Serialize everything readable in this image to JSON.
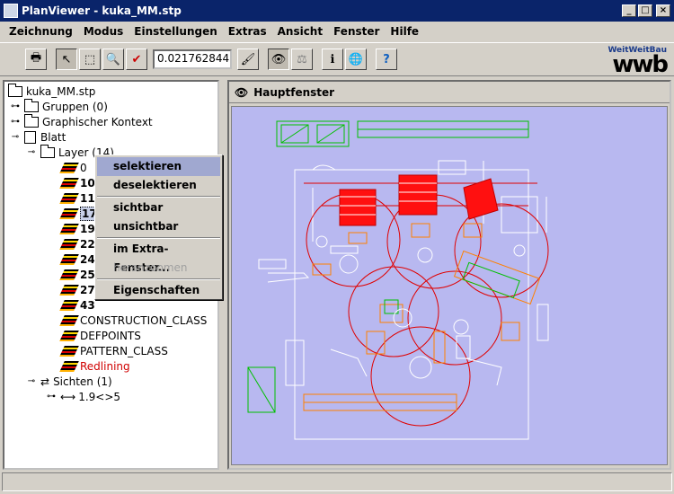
{
  "window": {
    "title": "PlanViewer - kuka_MM.stp",
    "min": "_",
    "max": "□",
    "close": "×"
  },
  "menu": [
    {
      "label": "Zeichnung"
    },
    {
      "label": "Modus"
    },
    {
      "label": "Einstellungen"
    },
    {
      "label": "Extras"
    },
    {
      "label": "Ansicht"
    },
    {
      "label": "Fenster"
    },
    {
      "label": "Hilfe"
    }
  ],
  "toolbar": {
    "zoom_value": "0.021762844",
    "logo_small": "WeitWeitBau",
    "logo_big": "wwb",
    "icons": {
      "print": "🖶",
      "pointer": "↖",
      "select_box": "⬚",
      "zoom": "🔍",
      "check": "✔",
      "brush": "🖌",
      "binoculars": "👁",
      "scales": "⚖",
      "info": "ℹ",
      "globe": "🌐",
      "help": "?"
    }
  },
  "tree": {
    "root": "kuka_MM.stp",
    "gruppen": "Gruppen (0)",
    "kontext": "Graphischer Kontext",
    "blatt": "Blatt",
    "layer": "Layer (14)",
    "layers": [
      "0",
      "10",
      "11",
      "17",
      "19",
      "22",
      "24",
      "25",
      "27",
      "43",
      "CONSTRUCTION_CLASS",
      "DEFPOINTS",
      "PATTERN_CLASS",
      "Redlining"
    ],
    "sichten": "Sichten (1)",
    "sicht": "1.9<>5"
  },
  "context_menu": {
    "items": [
      "selektieren",
      "deselektieren",
      "sichtbar",
      "unsichtbar",
      "im Extra-Fenster...",
      "heranzoomen",
      "Eigenschaften"
    ]
  },
  "view": {
    "title": "Hauptfenster"
  },
  "colors": {
    "canvas_bg": "#b8b8f0",
    "cad_red": "#e00000",
    "cad_orange": "#ff8000",
    "cad_green": "#00c000",
    "cad_white": "#ffffff",
    "selection": "#a0a8d0"
  }
}
